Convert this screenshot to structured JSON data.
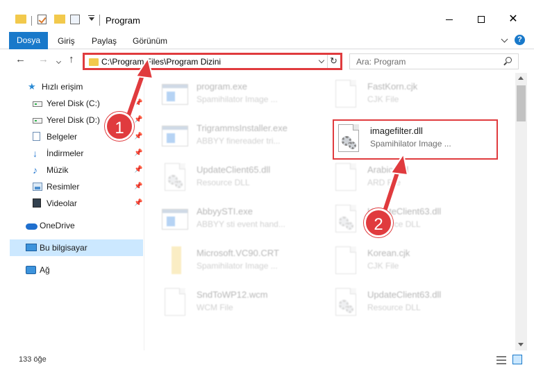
{
  "window": {
    "title": "Program"
  },
  "ribbon": {
    "tabs": [
      "Dosya",
      "Giriş",
      "Paylaş",
      "Görünüm"
    ],
    "help": "?"
  },
  "nav": {
    "back": "←",
    "forward": "→",
    "up": "↑",
    "address": "C:\\Program Files\\Program Dizini",
    "refresh": "↻",
    "search_placeholder": "Ara: Program"
  },
  "sidebar": {
    "quick_access": "Hızlı erişim",
    "items": [
      {
        "label": "Yerel Disk (C:)",
        "icon": "drive-icon"
      },
      {
        "label": "Yerel Disk (D:)",
        "icon": "drive-icon"
      },
      {
        "label": "Belgeler",
        "icon": "documents-icon"
      },
      {
        "label": "İndirmeler",
        "icon": "downloads-icon"
      },
      {
        "label": "Müzik",
        "icon": "music-icon"
      },
      {
        "label": "Resimler",
        "icon": "pictures-icon"
      },
      {
        "label": "Videolar",
        "icon": "videos-icon"
      }
    ],
    "onedrive": "OneDrive",
    "this_pc": "Bu bilgisayar",
    "network": "Ağ"
  },
  "files": {
    "left": [
      {
        "name": "program.exe",
        "type": "Spamihilator Image ..."
      },
      {
        "name": "TrigrammsInstaller.exe",
        "type": "ABBYY finereader tri..."
      },
      {
        "name": "UpdateClient65.dll",
        "type": "Resource DLL"
      },
      {
        "name": "AbbyySTI.exe",
        "type": "ABBYY sti event hand..."
      },
      {
        "name": "Microsoft.VC90.CRT",
        "type": "Spamihilator Image ..."
      },
      {
        "name": "SndToWP12.wcm",
        "type": "WCM File"
      }
    ],
    "right": [
      {
        "name": "FastKorn.cjk",
        "type": "CJK File"
      },
      {
        "name": "imagefilter.dll",
        "type": "Spamihilator Image ..."
      },
      {
        "name": "Arabic.ard",
        "type": "ARD File"
      },
      {
        "name": "UpdateClient63.dll",
        "type": "Resource DLL"
      },
      {
        "name": "Korean.cjk",
        "type": "CJK File"
      },
      {
        "name": "UpdateClient63.dll",
        "type": "Resource DLL"
      }
    ]
  },
  "annotations": {
    "step1": "1",
    "step2": "2",
    "color": "#e03b3e"
  },
  "status": {
    "count": "133 öğe"
  }
}
